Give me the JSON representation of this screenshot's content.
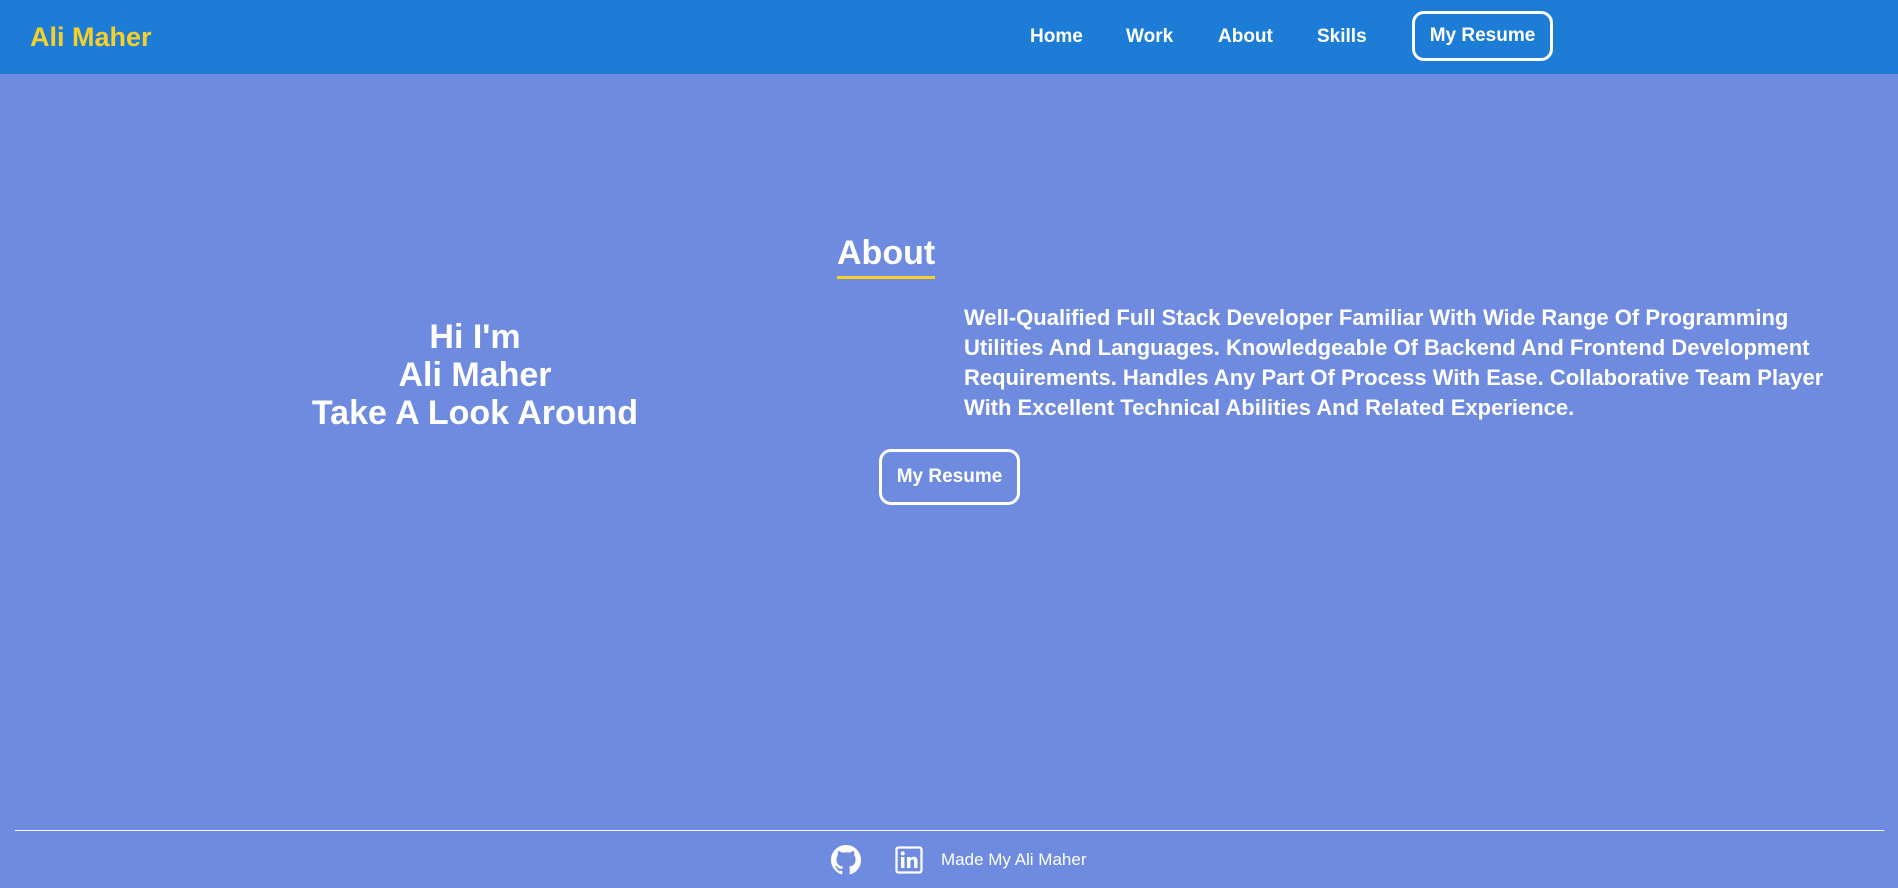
{
  "navbar": {
    "brand": "Ali Maher",
    "links": [
      "Home",
      "Work",
      "About",
      "Skills"
    ],
    "resume_button": "My Resume"
  },
  "hero": {
    "line1": "Hi I'm",
    "line2": "Ali Maher",
    "line3": "Take A Look Around"
  },
  "about": {
    "heading": "About",
    "text": "Well-Qualified Full Stack Developer Familiar With Wide Range Of Programming Utilities And Languages. Knowledgeable Of Backend And Frontend Development Requirements. Handles Any Part Of Process With Ease. Collaborative Team Player With Excellent Technical Abilities And Related Experience.",
    "resume_button": "My Resume"
  },
  "footer": {
    "icons": [
      "github-icon",
      "linkedin-icon"
    ],
    "text": "Made My Ali Maher"
  },
  "colors": {
    "navbar": "#1d7dd6",
    "background": "#6e8be0",
    "brand": "#f6cf2a",
    "underline": "#f6cf2a",
    "text": "#ffffff"
  }
}
